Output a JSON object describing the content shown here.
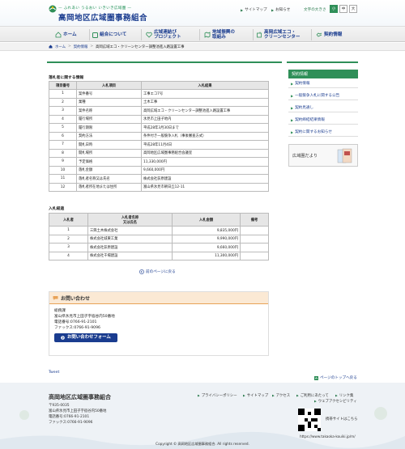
{
  "header": {
    "tagline": "— ふれあい うるおい いきいき広域圏 —",
    "site_name": "高岡地区広域圏事務組合",
    "utility": {
      "sitemap": "サイトマップ",
      "news": "お知らせ",
      "font_size_label": "文字の大きさ"
    },
    "font_sizes": [
      "小",
      "中",
      "大"
    ]
  },
  "nav": [
    "ホーム",
    "組合について",
    "広域連結び\nプロジェクト",
    "地域振興の\n取組み",
    "高岡広域エコ・\nクリーンセンター",
    "契約情報"
  ],
  "breadcrumb": {
    "home": "ホーム",
    "parent": "契約情報",
    "current": "高岡広域エコ・クリーンセンター調整池進入路設置工事"
  },
  "bidder_section": {
    "title": "落札者に関する情報",
    "headers": [
      "項目番号",
      "入札項目",
      "入札結果"
    ],
    "rows": [
      [
        "1",
        "案件番号",
        "工事エコ7号"
      ],
      [
        "2",
        "業種",
        "土木工事"
      ],
      [
        "3",
        "案件名称",
        "高岡広域エコ・クリーンセンター調整池進入路設置工事"
      ],
      [
        "4",
        "履行場所",
        "氷見市上田子地内"
      ],
      [
        "5",
        "履行期限",
        "平成28年3月30日まで"
      ],
      [
        "6",
        "契約方法",
        "条件付き一般競争入札（事後審査方式）"
      ],
      [
        "7",
        "開札日時",
        "平成28年11月4日"
      ],
      [
        "8",
        "開札場所",
        "高岡地区広域圏事務組合会議室"
      ],
      [
        "9",
        "予定価格",
        "11,330,000円"
      ],
      [
        "10",
        "落札金額",
        "9,660,000円"
      ],
      [
        "11",
        "落札者名称又は氏名",
        "株式会社荻原建設"
      ],
      [
        "12",
        "落札者所在地または住所",
        "富山県氷見市朝日丘12-11"
      ]
    ]
  },
  "bidding_section": {
    "title": "入札経過",
    "headers": [
      "入札者",
      "入札者名称\n又は氏名",
      "入札金額",
      "備考"
    ],
    "rows": [
      [
        "1",
        "三興土木株式会社",
        "9,835,000円",
        ""
      ],
      [
        "2",
        "株式会社城東工業",
        "9,990,000円",
        ""
      ],
      [
        "3",
        "株式会社荻原建設",
        "9,660,000円",
        ""
      ],
      [
        "4",
        "株式会社千場建設",
        "11,300,000円",
        ""
      ]
    ]
  },
  "back_link": "前のページに戻る",
  "inquiry": {
    "title": "お問い合わせ",
    "dept": "総務課",
    "address": "富山県氷見市上田子字宿谷内50番地",
    "phone": "電話番号:0766-91-2101",
    "fax": "ファックス:0766-91-9096",
    "button": "お問い合わせフォーム"
  },
  "sidebar": {
    "title": "契約情報",
    "items": [
      "契約情報",
      "一般競争入札に関する公告",
      "契約見通し",
      "契約締結結果情報",
      "契約に関するお知らせ"
    ],
    "banner": "広域圏だより"
  },
  "footer": {
    "tweet": "Tweet",
    "page_top": "ページのトップへ戻る",
    "org_name": "高岡地区広域圏事務組合",
    "postal": "〒935-0035",
    "address": "富山県氷見市上田子字宿谷内50番地",
    "phone": "電話番号:0766-91-2101",
    "fax": "ファックス:0766-91-9096",
    "links_row1": [
      "プライバシーポリシー",
      "サイトマップ",
      "アクセス",
      "ご利用にあたって",
      "リンク集"
    ],
    "links_row2": [
      "ウェブアクセシビリティ"
    ],
    "mobile_label": "携帯サイトはこちら",
    "mobile_url": "https://www.takaoka-kouiki.jp/m/",
    "copyright": "Copyright © 高岡地区広域圏事務組合. All rights reserved."
  },
  "colors": {
    "brand_green": "#2f8f58",
    "brand_navy": "#1a3c8f",
    "inquiry_accent": "#e8a257"
  }
}
